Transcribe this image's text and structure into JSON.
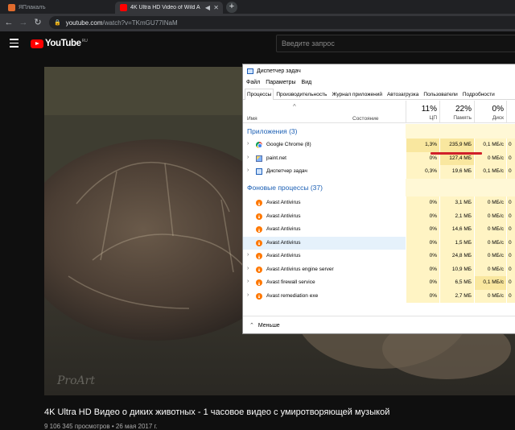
{
  "browser": {
    "tabs": [
      {
        "title": "ЯПлакалъ",
        "active": false
      },
      {
        "title": "4K Ultra HD Video of Wild A",
        "active": true
      }
    ],
    "new_tab": "+",
    "nav": {
      "back": "←",
      "forward": "→",
      "reload": "↻"
    },
    "url_host": "youtube.com",
    "url_path": "/watch?v=TKmGU77INaM"
  },
  "youtube": {
    "logo_text": "YouTube",
    "logo_region": "RU",
    "search_placeholder": "Введите запрос",
    "video_title": "4K Ultra HD Видео о диких животных - 1 часовое видео с умиротворяющей музыкой",
    "views_line": "9 106 345 просмотров • 26 мая 2017 г.",
    "actions": "",
    "watermark": "ProArt"
  },
  "taskmgr": {
    "title": "Диспетчер задач",
    "menu": [
      "Файл",
      "Параметры",
      "Вид"
    ],
    "tabs": [
      "Процессы",
      "Производительность",
      "Журнал приложений",
      "Автозагрузка",
      "Пользователи",
      "Подробности"
    ],
    "columns": {
      "name": "Имя",
      "status": "Состояние",
      "cpu_pct": "11%",
      "cpu_label": "ЦП",
      "mem_pct": "22%",
      "mem_label": "Память",
      "disk_pct": "0%",
      "disk_label": "Диск"
    },
    "group_apps": "Приложения (3)",
    "apps": [
      {
        "name": "Google Chrome (8)",
        "cpu": "1,3%",
        "mem": "235,9 МБ",
        "disk": "0,1 МБ/с",
        "net": "0",
        "icon": "chrome-icon"
      },
      {
        "name": "paint.net",
        "cpu": "0%",
        "mem": "127,4 МБ",
        "disk": "0 МБ/с",
        "net": "0",
        "icon": "paint-icon"
      },
      {
        "name": "Диспетчер задач",
        "cpu": "0,3%",
        "mem": "19,6 МБ",
        "disk": "0,1 МБ/с",
        "net": "0",
        "icon": "task-manager-icon"
      }
    ],
    "group_bg": "Фоновые процессы (37)",
    "bg": [
      {
        "name": "Avast Antivirus",
        "cpu": "0%",
        "mem": "3,1 МБ",
        "disk": "0 МБ/с",
        "net": "0"
      },
      {
        "name": "Avast Antivirus",
        "cpu": "0%",
        "mem": "2,1 МБ",
        "disk": "0 МБ/с",
        "net": "0"
      },
      {
        "name": "Avast Antivirus",
        "cpu": "0%",
        "mem": "14,6 МБ",
        "disk": "0 МБ/с",
        "net": "0"
      },
      {
        "name": "Avast Antivirus",
        "cpu": "0%",
        "mem": "1,5 МБ",
        "disk": "0 МБ/с",
        "net": "0"
      },
      {
        "name": "Avast Antivirus",
        "cpu": "0%",
        "mem": "24,8 МБ",
        "disk": "0 МБ/с",
        "net": "0"
      },
      {
        "name": "Avast Antivirus engine server",
        "cpu": "0%",
        "mem": "10,9 МБ",
        "disk": "0 МБ/с",
        "net": "0"
      },
      {
        "name": "Avast firewall service",
        "cpu": "0%",
        "mem": "6,5 МБ",
        "disk": "0,1 МБ/с",
        "net": "0"
      },
      {
        "name": "Avast remediation exe",
        "cpu": "0%",
        "mem": "2,7 МБ",
        "disk": "0 МБ/с",
        "net": "0"
      }
    ],
    "footer": "Меньше",
    "footer_icon": "chevron-up-icon"
  },
  "colors": {
    "youtube_red": "#ff0000",
    "highlight": "#d0202a",
    "tm_blue": "#1b5fb4",
    "heat_light": "#fff4c4",
    "heat_strong": "#f9e79f"
  }
}
